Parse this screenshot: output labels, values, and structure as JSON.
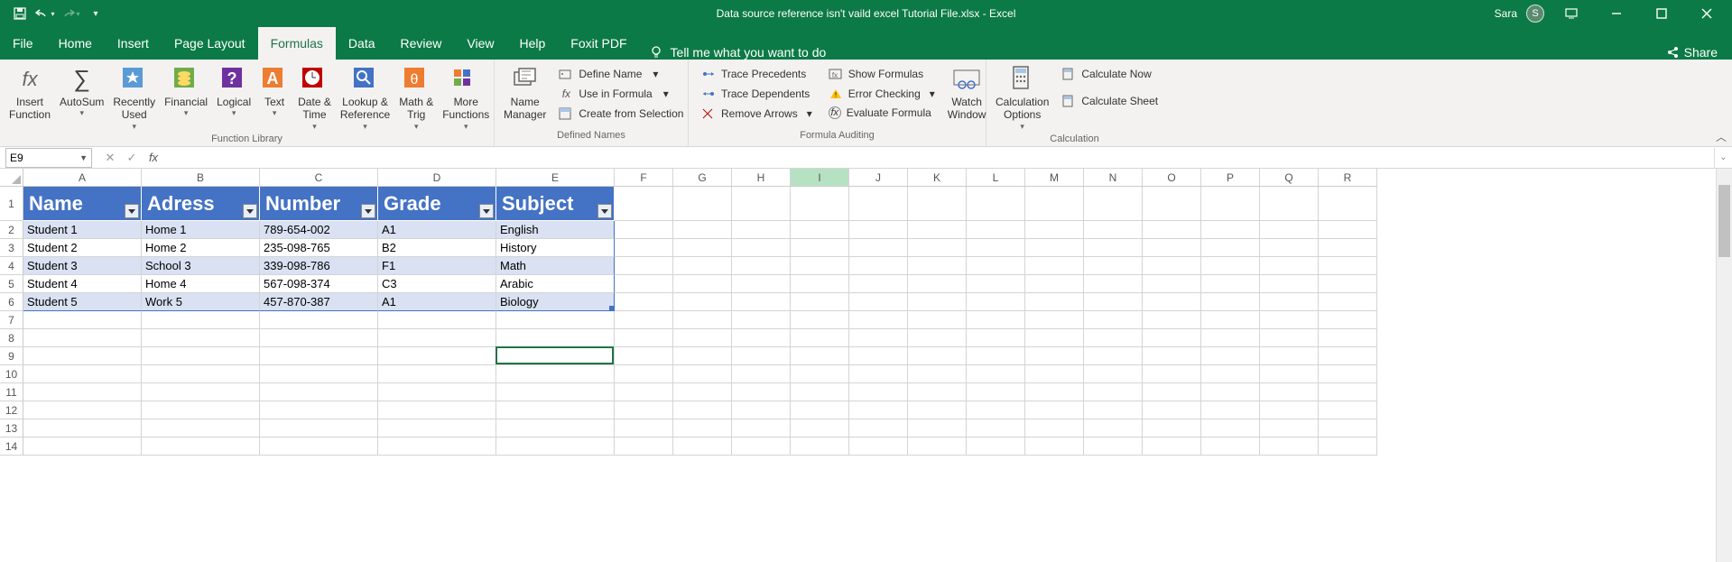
{
  "titlebar": {
    "title": "Data source reference isn't vaild excel Tutorial File.xlsx  -  Excel",
    "user_name": "Sara",
    "user_initial": "S"
  },
  "tabs": [
    "File",
    "Home",
    "Insert",
    "Page Layout",
    "Formulas",
    "Data",
    "Review",
    "View",
    "Help",
    "Foxit PDF"
  ],
  "active_tab": "Formulas",
  "tellme": "Tell me what you want to do",
  "share": "Share",
  "ribbon": {
    "groups": {
      "funclib": {
        "label": "Function Library",
        "insert_function": "Insert\nFunction",
        "autosum": "AutoSum",
        "recently": "Recently\nUsed",
        "financial": "Financial",
        "logical": "Logical",
        "text": "Text",
        "datetime": "Date &\nTime",
        "lookup": "Lookup &\nReference",
        "mathtrig": "Math &\nTrig",
        "more": "More\nFunctions"
      },
      "defnames": {
        "label": "Defined Names",
        "name_manager": "Name\nManager",
        "define_name": "Define Name",
        "use_formula": "Use in Formula",
        "create_sel": "Create from Selection"
      },
      "audit": {
        "label": "Formula Auditing",
        "trace_prec": "Trace Precedents",
        "trace_dep": "Trace Dependents",
        "remove_arr": "Remove Arrows",
        "show_formulas": "Show Formulas",
        "error_check": "Error Checking",
        "eval": "Evaluate Formula",
        "watch": "Watch\nWindow"
      },
      "calc": {
        "label": "Calculation",
        "options": "Calculation\nOptions",
        "calc_now": "Calculate Now",
        "calc_sheet": "Calculate Sheet"
      }
    }
  },
  "namebox": "E9",
  "columns": [
    "A",
    "B",
    "C",
    "D",
    "E",
    "F",
    "G",
    "H",
    "I",
    "J",
    "K",
    "L",
    "M",
    "N",
    "O",
    "P",
    "Q",
    "R"
  ],
  "highlight_col": "I",
  "colwidths": {
    "A": 131,
    "B": 131,
    "C": 131,
    "D": 131,
    "E": 131,
    "F": 65,
    "G": 65,
    "H": 65,
    "I": 65,
    "J": 65,
    "K": 65,
    "L": 65,
    "M": 65,
    "N": 65,
    "O": 65,
    "P": 65,
    "Q": 65,
    "R": 65
  },
  "visible_rows": 14,
  "table": {
    "headers": [
      "Name",
      "Adress",
      "Number",
      "Grade",
      "Subject"
    ],
    "rows": [
      [
        "Student 1",
        "Home 1",
        "789-654-002",
        "A1",
        "English"
      ],
      [
        "Student 2",
        "Home 2",
        "235-098-765",
        "B2",
        "History"
      ],
      [
        "Student 3",
        "School 3",
        "339-098-786",
        "F1",
        "Math"
      ],
      [
        "Student 4",
        "Home 4",
        "567-098-374",
        "C3",
        "Arabic"
      ],
      [
        "Student 5",
        "Work 5",
        "457-870-387",
        "A1",
        "Biology"
      ]
    ]
  },
  "active_cell": {
    "col": "E",
    "row": 9
  }
}
